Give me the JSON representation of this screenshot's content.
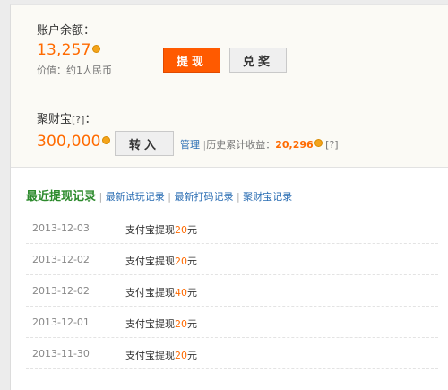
{
  "account": {
    "balance_label": "账户余额：",
    "balance_value": "13,257",
    "value_note": "价值：约1人民币",
    "withdraw_button": "提现",
    "redeem_button": "兑奖"
  },
  "jucaibao": {
    "label": "聚财宝",
    "help": "[?]",
    "colon": "：",
    "value": "300,000",
    "transfer_button": "转入",
    "manage_link": "管理",
    "divider": "|",
    "history_label": "历史累计收益：",
    "history_value": "20,296",
    "history_help": "[?]"
  },
  "tabs": {
    "active": "最近提现记录",
    "separator": "|",
    "items": [
      "最新试玩记录",
      "最新打码记录",
      "聚财宝记录"
    ]
  },
  "records": [
    {
      "date": "2013-12-03",
      "desc": "支付宝提现",
      "amount": "20",
      "unit": "元"
    },
    {
      "date": "2013-12-02",
      "desc": "支付宝提现",
      "amount": "20",
      "unit": "元"
    },
    {
      "date": "2013-12-02",
      "desc": "支付宝提现",
      "amount": "40",
      "unit": "元"
    },
    {
      "date": "2013-12-01",
      "desc": "支付宝提现",
      "amount": "20",
      "unit": "元"
    },
    {
      "date": "2013-11-30",
      "desc": "支付宝提现",
      "amount": "20",
      "unit": "元"
    }
  ]
}
